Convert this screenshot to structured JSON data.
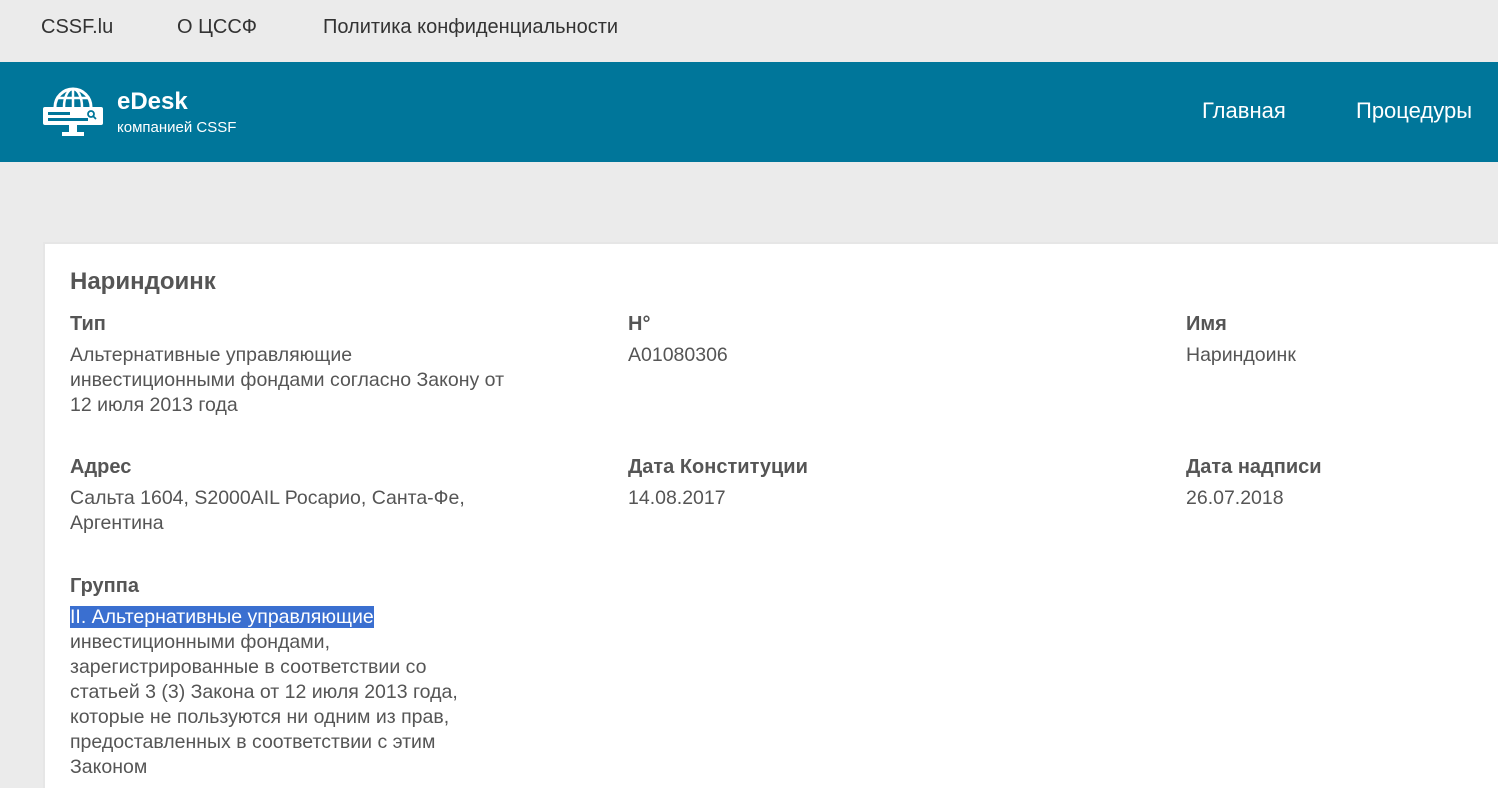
{
  "top_links": [
    "CSSF.lu",
    "О ЦССФ",
    "Политика конфиденциальности"
  ],
  "brand": {
    "title": "eDesk",
    "subtitle": "компанией CSSF",
    "logo_icon": "globe-monitor-icon"
  },
  "nav": [
    "Главная",
    "Процедуры"
  ],
  "colors": {
    "header_bg": "#00769a",
    "page_bg": "#ebebeb",
    "selection": "#3a6fd0"
  },
  "entity": {
    "title": "Нариндоинк",
    "fields": {
      "type": {
        "label": "Тип",
        "lines": [
          "Альтернативные управляющие",
          "инвестиционными фондами согласно Закону от",
          "12 июля 2013 года"
        ]
      },
      "number": {
        "label": "Н°",
        "value": "A01080306"
      },
      "name": {
        "label": "Имя",
        "value": "Нариндоинк"
      },
      "address": {
        "label": "Адрес",
        "lines": [
          "Сальта 1604, S2000AIL Росарио, Санта-Фе,",
          "Аргентина"
        ]
      },
      "constitution_date": {
        "label": "Дата Конституции",
        "value": "14.08.2017"
      },
      "inscription_date": {
        "label": "Дата надписи",
        "value": "26.07.2018"
      },
      "group": {
        "label": "Группа",
        "selected_text": "II. Альтернативные управляющие",
        "lines": [
          "инвестиционными фондами,",
          "зарегистрированные в соответствии со",
          "статьей 3 (3) Закона от 12 июля 2013 года,",
          "которые не пользуются ни одним из прав,",
          "предоставленных в соответствии с этим",
          "Законом"
        ]
      }
    }
  }
}
